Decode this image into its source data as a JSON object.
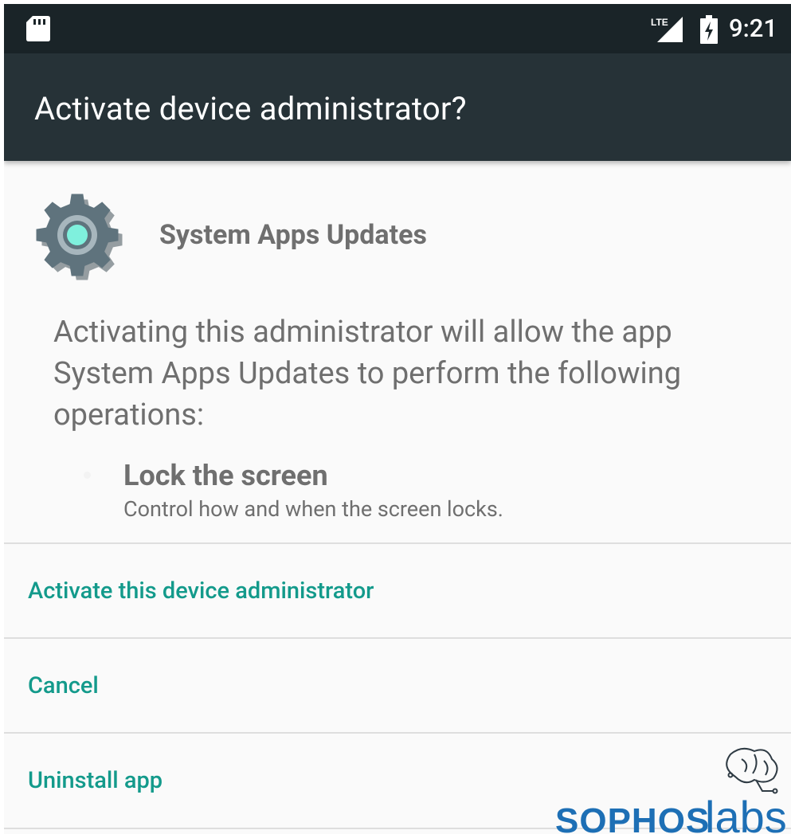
{
  "status_bar": {
    "time": "9:21",
    "network": "LTE",
    "icons": [
      "sd-card-icon",
      "lte-signal-icon",
      "battery-charging-icon"
    ]
  },
  "app_bar": {
    "title": "Activate device administrator?"
  },
  "app": {
    "name": "System Apps Updates",
    "icon": "gear-icon"
  },
  "description": "Activating this administrator will allow the app System Apps Updates to perform the following operations:",
  "policies": [
    {
      "title": "Lock the screen",
      "description": "Control how and when the screen locks."
    }
  ],
  "actions": {
    "activate_label": "Activate this device administrator",
    "cancel_label": "Cancel",
    "uninstall_label": "Uninstall app"
  },
  "watermark": {
    "brand": "sophoslabs"
  },
  "colors": {
    "status_bar": "#1a2428",
    "app_bar": "#263237",
    "background": "#fafafa",
    "accent": "#139a8b",
    "text_secondary": "#6f6f6f",
    "divider": "#dedede",
    "watermark": "#1d6fb5"
  }
}
